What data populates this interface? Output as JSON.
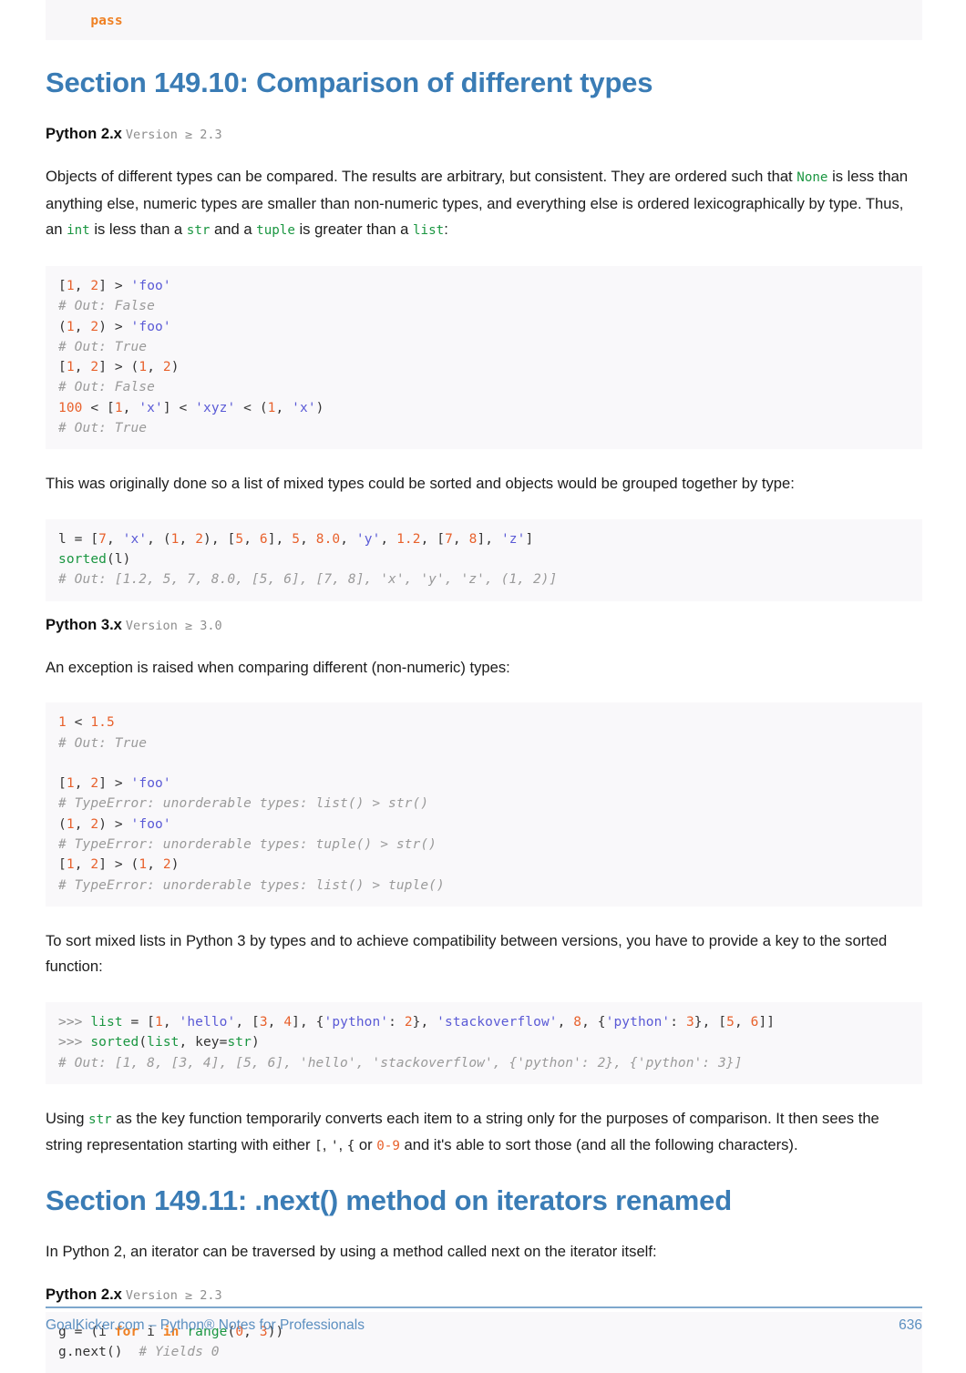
{
  "top_fragment": {
    "indent": "    ",
    "keyword": "pass"
  },
  "section_1": {
    "heading": "Section 149.10: Comparison of different types",
    "version_label": {
      "name": "Python 2.x",
      "requirement": "Version ≥ 2.3"
    },
    "paragraph_1": {
      "part_1": "Objects of different types can be compared. The results are arbitrary, but consistent. They are ordered such that ",
      "code_1": "None",
      "part_2": " is less than anything else, numeric types are smaller than non-numeric types, and everything else is ordered lexicographically by type. Thus, an ",
      "code_2": "int",
      "part_3": " is less than a ",
      "code_3": "str",
      "part_4": " and a ",
      "code_4": "tuple",
      "part_5": " is greater than a ",
      "code_5": "list",
      "part_6": ":"
    },
    "code_block_1": {
      "lines": [
        {
          "tokens": [
            {
              "t": "[",
              "c": "pl"
            },
            {
              "t": "1",
              "c": "num"
            },
            {
              "t": ", ",
              "c": "pl"
            },
            {
              "t": "2",
              "c": "num"
            },
            {
              "t": "] > ",
              "c": "pl"
            },
            {
              "t": "'foo'",
              "c": "str"
            }
          ]
        },
        {
          "tokens": [
            {
              "t": "# Out: False",
              "c": "cm"
            }
          ]
        },
        {
          "tokens": [
            {
              "t": "(",
              "c": "pl"
            },
            {
              "t": "1",
              "c": "num"
            },
            {
              "t": ", ",
              "c": "pl"
            },
            {
              "t": "2",
              "c": "num"
            },
            {
              "t": ") > ",
              "c": "pl"
            },
            {
              "t": "'foo'",
              "c": "str"
            }
          ]
        },
        {
          "tokens": [
            {
              "t": "# Out: True",
              "c": "cm"
            }
          ]
        },
        {
          "tokens": [
            {
              "t": "[",
              "c": "pl"
            },
            {
              "t": "1",
              "c": "num"
            },
            {
              "t": ", ",
              "c": "pl"
            },
            {
              "t": "2",
              "c": "num"
            },
            {
              "t": "] > (",
              "c": "pl"
            },
            {
              "t": "1",
              "c": "num"
            },
            {
              "t": ", ",
              "c": "pl"
            },
            {
              "t": "2",
              "c": "num"
            },
            {
              "t": ")",
              "c": "pl"
            }
          ]
        },
        {
          "tokens": [
            {
              "t": "# Out: False",
              "c": "cm"
            }
          ]
        },
        {
          "tokens": [
            {
              "t": "100",
              "c": "num"
            },
            {
              "t": " < [",
              "c": "pl"
            },
            {
              "t": "1",
              "c": "num"
            },
            {
              "t": ", ",
              "c": "pl"
            },
            {
              "t": "'x'",
              "c": "str"
            },
            {
              "t": "] < ",
              "c": "pl"
            },
            {
              "t": "'xyz'",
              "c": "str"
            },
            {
              "t": " < (",
              "c": "pl"
            },
            {
              "t": "1",
              "c": "num"
            },
            {
              "t": ", ",
              "c": "pl"
            },
            {
              "t": "'x'",
              "c": "str"
            },
            {
              "t": ")",
              "c": "pl"
            }
          ]
        },
        {
          "tokens": [
            {
              "t": "# Out: True",
              "c": "cm"
            }
          ]
        }
      ]
    },
    "paragraph_2": "This was originally done so a list of mixed types could be sorted and objects would be grouped together by type:",
    "code_block_2": {
      "lines": [
        {
          "tokens": [
            {
              "t": "l = [",
              "c": "pl"
            },
            {
              "t": "7",
              "c": "num"
            },
            {
              "t": ", ",
              "c": "pl"
            },
            {
              "t": "'x'",
              "c": "str"
            },
            {
              "t": ", (",
              "c": "pl"
            },
            {
              "t": "1",
              "c": "num"
            },
            {
              "t": ", ",
              "c": "pl"
            },
            {
              "t": "2",
              "c": "num"
            },
            {
              "t": "), [",
              "c": "pl"
            },
            {
              "t": "5",
              "c": "num"
            },
            {
              "t": ", ",
              "c": "pl"
            },
            {
              "t": "6",
              "c": "num"
            },
            {
              "t": "], ",
              "c": "pl"
            },
            {
              "t": "5",
              "c": "num"
            },
            {
              "t": ", ",
              "c": "pl"
            },
            {
              "t": "8.0",
              "c": "num"
            },
            {
              "t": ", ",
              "c": "pl"
            },
            {
              "t": "'y'",
              "c": "str"
            },
            {
              "t": ", ",
              "c": "pl"
            },
            {
              "t": "1.2",
              "c": "num"
            },
            {
              "t": ", [",
              "c": "pl"
            },
            {
              "t": "7",
              "c": "num"
            },
            {
              "t": ", ",
              "c": "pl"
            },
            {
              "t": "8",
              "c": "num"
            },
            {
              "t": "], ",
              "c": "pl"
            },
            {
              "t": "'z'",
              "c": "str"
            },
            {
              "t": "]",
              "c": "pl"
            }
          ]
        },
        {
          "tokens": [
            {
              "t": "sorted",
              "c": "bi"
            },
            {
              "t": "(l)",
              "c": "pl"
            }
          ]
        },
        {
          "tokens": [
            {
              "t": "# Out: [1.2, 5, 7, 8.0, [5, 6], [7, 8], 'x', 'y', 'z', (1, 2)]",
              "c": "cm"
            }
          ]
        }
      ]
    },
    "version_label_2": {
      "name": "Python 3.x",
      "requirement": "Version ≥ 3.0"
    },
    "paragraph_3": "An exception is raised when comparing different (non-numeric) types:",
    "code_block_3": {
      "lines": [
        {
          "tokens": [
            {
              "t": "1",
              "c": "num"
            },
            {
              "t": " < ",
              "c": "pl"
            },
            {
              "t": "1.5",
              "c": "num"
            }
          ]
        },
        {
          "tokens": [
            {
              "t": "# Out: True",
              "c": "cm"
            }
          ]
        },
        {
          "tokens": []
        },
        {
          "tokens": [
            {
              "t": "[",
              "c": "pl"
            },
            {
              "t": "1",
              "c": "num"
            },
            {
              "t": ", ",
              "c": "pl"
            },
            {
              "t": "2",
              "c": "num"
            },
            {
              "t": "] > ",
              "c": "pl"
            },
            {
              "t": "'foo'",
              "c": "str"
            }
          ]
        },
        {
          "tokens": [
            {
              "t": "# TypeError: unorderable types: list() > str()",
              "c": "cm"
            }
          ]
        },
        {
          "tokens": [
            {
              "t": "(",
              "c": "pl"
            },
            {
              "t": "1",
              "c": "num"
            },
            {
              "t": ", ",
              "c": "pl"
            },
            {
              "t": "2",
              "c": "num"
            },
            {
              "t": ") > ",
              "c": "pl"
            },
            {
              "t": "'foo'",
              "c": "str"
            }
          ]
        },
        {
          "tokens": [
            {
              "t": "# TypeError: unorderable types: tuple() > str()",
              "c": "cm"
            }
          ]
        },
        {
          "tokens": [
            {
              "t": "[",
              "c": "pl"
            },
            {
              "t": "1",
              "c": "num"
            },
            {
              "t": ", ",
              "c": "pl"
            },
            {
              "t": "2",
              "c": "num"
            },
            {
              "t": "] > (",
              "c": "pl"
            },
            {
              "t": "1",
              "c": "num"
            },
            {
              "t": ", ",
              "c": "pl"
            },
            {
              "t": "2",
              "c": "num"
            },
            {
              "t": ")",
              "c": "pl"
            }
          ]
        },
        {
          "tokens": [
            {
              "t": "# TypeError: unorderable types: list() > tuple()",
              "c": "cm"
            }
          ]
        }
      ]
    },
    "paragraph_4": "To sort mixed lists in Python 3 by types and to achieve compatibility between versions, you have to provide a key to the sorted function:",
    "code_block_4": {
      "lines": [
        {
          "tokens": [
            {
              "t": ">>> ",
              "c": "pr"
            },
            {
              "t": "list",
              "c": "bi"
            },
            {
              "t": " = [",
              "c": "pl"
            },
            {
              "t": "1",
              "c": "num"
            },
            {
              "t": ", ",
              "c": "pl"
            },
            {
              "t": "'hello'",
              "c": "str"
            },
            {
              "t": ", [",
              "c": "pl"
            },
            {
              "t": "3",
              "c": "num"
            },
            {
              "t": ", ",
              "c": "pl"
            },
            {
              "t": "4",
              "c": "num"
            },
            {
              "t": "], {",
              "c": "pl"
            },
            {
              "t": "'python'",
              "c": "str"
            },
            {
              "t": ": ",
              "c": "pl"
            },
            {
              "t": "2",
              "c": "num"
            },
            {
              "t": "}, ",
              "c": "pl"
            },
            {
              "t": "'stackoverflow'",
              "c": "str"
            },
            {
              "t": ", ",
              "c": "pl"
            },
            {
              "t": "8",
              "c": "num"
            },
            {
              "t": ", {",
              "c": "pl"
            },
            {
              "t": "'python'",
              "c": "str"
            },
            {
              "t": ": ",
              "c": "pl"
            },
            {
              "t": "3",
              "c": "num"
            },
            {
              "t": "}, [",
              "c": "pl"
            },
            {
              "t": "5",
              "c": "num"
            },
            {
              "t": ", ",
              "c": "pl"
            },
            {
              "t": "6",
              "c": "num"
            },
            {
              "t": "]]",
              "c": "pl"
            }
          ]
        },
        {
          "tokens": [
            {
              "t": ">>> ",
              "c": "pr"
            },
            {
              "t": "sorted",
              "c": "bi"
            },
            {
              "t": "(",
              "c": "pl"
            },
            {
              "t": "list",
              "c": "bi"
            },
            {
              "t": ", key=",
              "c": "pl"
            },
            {
              "t": "str",
              "c": "bi"
            },
            {
              "t": ")",
              "c": "pl"
            }
          ]
        },
        {
          "tokens": [
            {
              "t": "# Out: [1, 8, [3, 4], [5, 6], 'hello', 'stackoverflow', {'python': 2}, {'python': 3}]",
              "c": "cm"
            }
          ]
        }
      ]
    },
    "paragraph_5": {
      "part_1": "Using ",
      "code_1": "str",
      "part_2": " as the key function temporarily converts each item to a string only for the purposes of comparison. It then sees the string representation starting with either ",
      "code_2": "[",
      "part_3": ", ",
      "code_3": "'",
      "part_4": ", ",
      "code_4": "{",
      "part_5": " or ",
      "code_5": "0-9",
      "part_6": " and it's able to sort those (and all the following characters)."
    }
  },
  "section_2": {
    "heading": "Section 149.11: .next() method on iterators renamed",
    "paragraph_1": "In Python 2, an iterator can be traversed by using a method called next on the iterator itself:",
    "version_label": {
      "name": "Python 2.x",
      "requirement": "Version ≥ 2.3"
    },
    "code_block_1": {
      "lines": [
        {
          "tokens": [
            {
              "t": "g = (i ",
              "c": "pl"
            },
            {
              "t": "for",
              "c": "k"
            },
            {
              "t": " i ",
              "c": "pl"
            },
            {
              "t": "in",
              "c": "k"
            },
            {
              "t": " ",
              "c": "pl"
            },
            {
              "t": "range",
              "c": "bi"
            },
            {
              "t": "(",
              "c": "pl"
            },
            {
              "t": "0",
              "c": "num"
            },
            {
              "t": ", ",
              "c": "pl"
            },
            {
              "t": "3",
              "c": "num"
            },
            {
              "t": "))",
              "c": "pl"
            }
          ]
        },
        {
          "tokens": [
            {
              "t": "g.next()  ",
              "c": "pl"
            },
            {
              "t": "# Yields 0",
              "c": "cm"
            }
          ]
        }
      ]
    }
  },
  "footer": {
    "left": "GoalKicker.com – Python® Notes for Professionals",
    "page": "636"
  },
  "colors": {
    "heading_blue": "#3a7cb5",
    "footer_blue": "#5b8fc0",
    "keyword_orange": "#ef8023",
    "builtin_green": "#1a9641",
    "number_orange": "#e8612c",
    "string_purple": "#5a5ad6",
    "comment_gray": "#9a9a9a",
    "code_bg": "#f9f8fa"
  }
}
